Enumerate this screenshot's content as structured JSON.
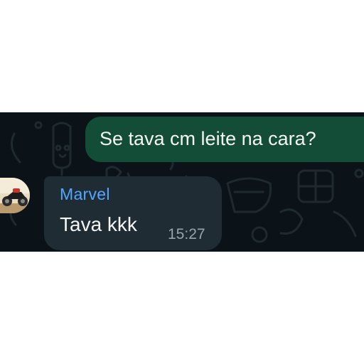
{
  "messages": [
    {
      "direction": "outgoing",
      "text": "Se tava cm leite na cara?"
    },
    {
      "direction": "incoming",
      "sender": "Marvel",
      "text": "Tava kkk",
      "time": "15:27"
    }
  ],
  "colors": {
    "chat_background": "#0c1318",
    "outgoing_bubble": "#134d37",
    "incoming_bubble": "#202c33",
    "sender_name": "#53a6ff",
    "timestamp": "#98a4ab"
  },
  "icons": [
    "doodle-wallpaper",
    "avatar-motorcycle"
  ]
}
